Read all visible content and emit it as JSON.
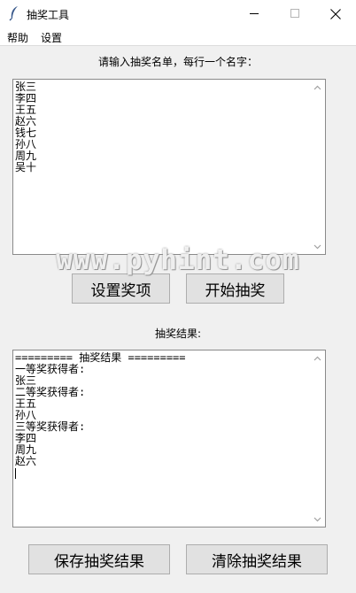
{
  "window": {
    "title": "抽奖工具"
  },
  "menu": {
    "help": "帮助",
    "settings": "设置"
  },
  "input_section": {
    "prompt": "请输入抽奖名单，每行一个名字：",
    "names_text": "张三\n李四\n王五\n赵六\n钱七\n孙八\n周九\n吴十"
  },
  "buttons": {
    "set_prizes": "设置奖项",
    "start_draw": "开始抽奖",
    "save_results": "保存抽奖结果",
    "clear_results": "清除抽奖结果"
  },
  "result_section": {
    "label": "抽奖结果:",
    "result_text": "========= 抽奖结果 =========\n一等奖获得者:\n张三\n二等奖获得者:\n王五\n孙八\n三等奖获得者:\n李四\n周九\n赵六"
  },
  "watermark": "www.pyhint.com"
}
